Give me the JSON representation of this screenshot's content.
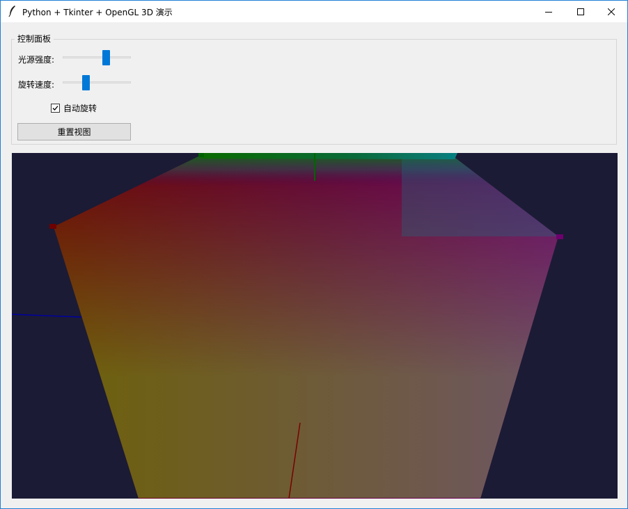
{
  "window": {
    "title": "Python + Tkinter + OpenGL 3D 演示",
    "icon": "feather-icon",
    "controls": [
      "minimize-icon",
      "maximize-icon",
      "close-icon"
    ]
  },
  "control_panel": {
    "legend": "控制面板",
    "light_intensity": {
      "label": "光源强度:",
      "value_fraction": 0.65
    },
    "rotation_speed": {
      "label": "旋转速度:",
      "value_fraction": 0.33
    },
    "auto_rotate": {
      "label": "自动旋转",
      "checked": true
    },
    "reset_button": "重置视图"
  },
  "viewport": {
    "background": "#1b1b35",
    "accent_slider": "#0078d7",
    "axes": {
      "x_color": "#7a0000",
      "y_color": "#006600",
      "z_color": "#0000a0"
    },
    "face_colors": {
      "top_left": "#6e0000",
      "top_center": "#006400",
      "top_right_cyan": "#00807f",
      "right": "#6e006e",
      "bottom_left": "#6e6e00",
      "bottom_right": "#6e5064"
    }
  }
}
